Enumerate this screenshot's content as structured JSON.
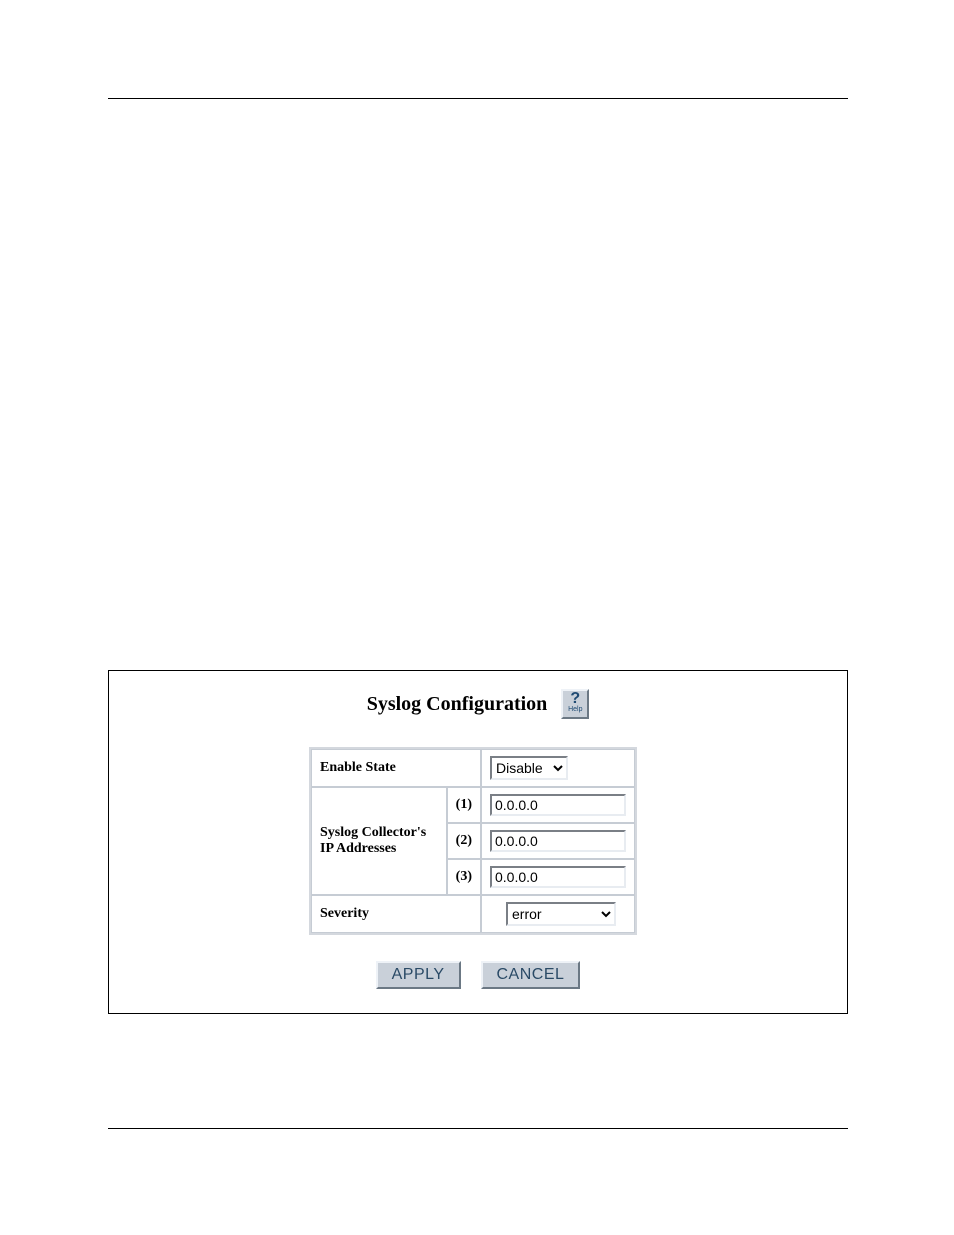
{
  "panel": {
    "title": "Syslog Configuration",
    "help_label": "Help"
  },
  "form": {
    "enable_state": {
      "label": "Enable State",
      "value": "Disable"
    },
    "collectors": {
      "label": "Syslog Collector's IP Addresses",
      "rows": [
        {
          "idx": "(1)",
          "value": "0.0.0.0"
        },
        {
          "idx": "(2)",
          "value": "0.0.0.0"
        },
        {
          "idx": "(3)",
          "value": "0.0.0.0"
        }
      ]
    },
    "severity": {
      "label": "Severity",
      "value": "error"
    }
  },
  "buttons": {
    "apply": "APPLY",
    "cancel": "CANCEL"
  }
}
